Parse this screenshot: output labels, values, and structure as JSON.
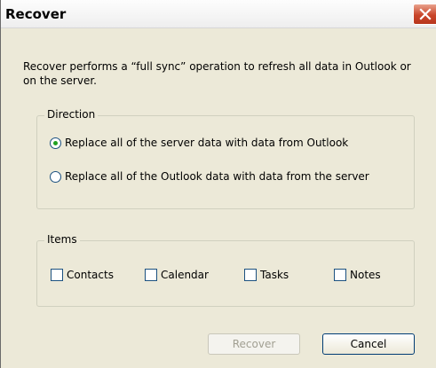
{
  "window": {
    "title": "Recover"
  },
  "description": "Recover performs a “full sync” operation to refresh all data in Outlook or on the server.",
  "direction": {
    "legend": "Direction",
    "options": [
      {
        "label": "Replace all of the server data with data from Outlook",
        "selected": true
      },
      {
        "label": "Replace all of the Outlook data with data from the server",
        "selected": false
      }
    ]
  },
  "items": {
    "legend": "Items",
    "checkboxes": [
      {
        "label": "Contacts",
        "checked": false
      },
      {
        "label": "Calendar",
        "checked": false
      },
      {
        "label": "Tasks",
        "checked": false
      },
      {
        "label": "Notes",
        "checked": false
      }
    ]
  },
  "buttons": {
    "recover_label": "Recover",
    "recover_enabled": false,
    "cancel_label": "Cancel"
  },
  "icons": {
    "close": "close-icon"
  },
  "colors": {
    "dialog_background": "#ece9d8",
    "close_button": "#c9452a",
    "radio_selected_dot": "#21a121"
  }
}
